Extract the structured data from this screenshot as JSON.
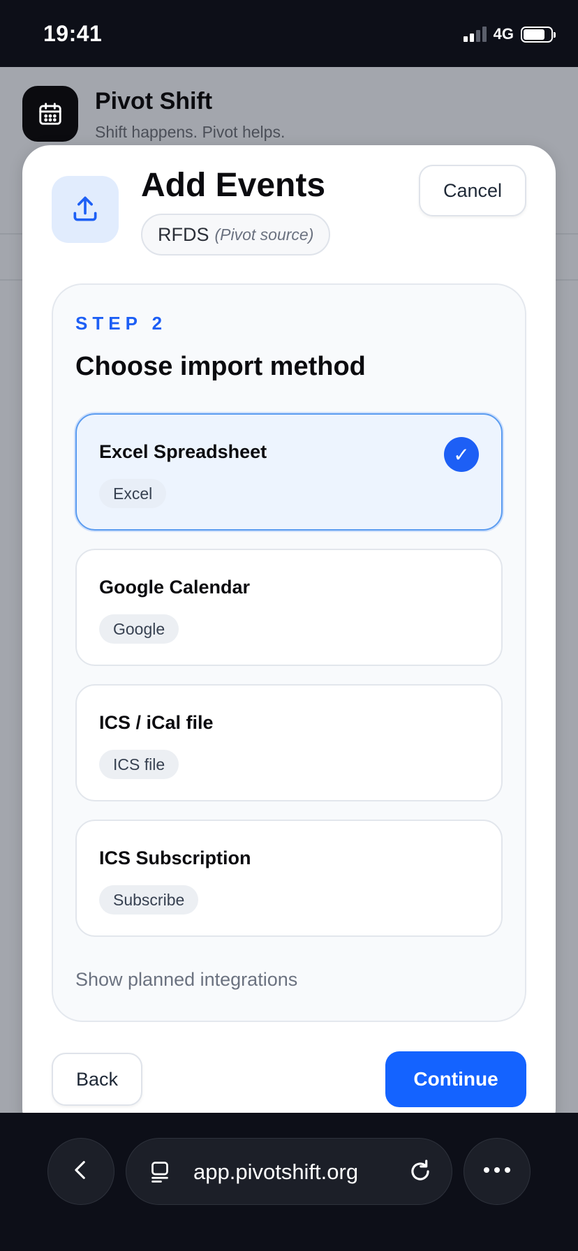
{
  "status_bar": {
    "time": "19:41",
    "network": "4G",
    "battery_level": 0.8,
    "signal_bars": 2
  },
  "app": {
    "icon": "calendar-icon",
    "title": "Pivot Shift",
    "subtitle": "Shift happens. Pivot helps."
  },
  "modal": {
    "icon": "upload-icon",
    "title": "Add Events",
    "source_name": "RFDS",
    "source_note": "(Pivot source)",
    "cancel_label": "Cancel",
    "step_label": "STEP 2",
    "step_title": "Choose import method",
    "options": [
      {
        "title": "Excel Spreadsheet",
        "tag": "Excel",
        "selected": true
      },
      {
        "title": "Google Calendar",
        "tag": "Google",
        "selected": false
      },
      {
        "title": "ICS / iCal file",
        "tag": "ICS file",
        "selected": false
      },
      {
        "title": "ICS Subscription",
        "tag": "Subscribe",
        "selected": false
      }
    ],
    "planned_link": "Show planned integrations",
    "back_label": "Back",
    "continue_label": "Continue",
    "accent_color": "#1463ff"
  },
  "browser": {
    "url": "app.pivotshift.org",
    "back_icon": "chevron-left-icon",
    "tabs_icon": "page-icon",
    "reload_icon": "reload-icon",
    "more_icon": "more-icon"
  }
}
